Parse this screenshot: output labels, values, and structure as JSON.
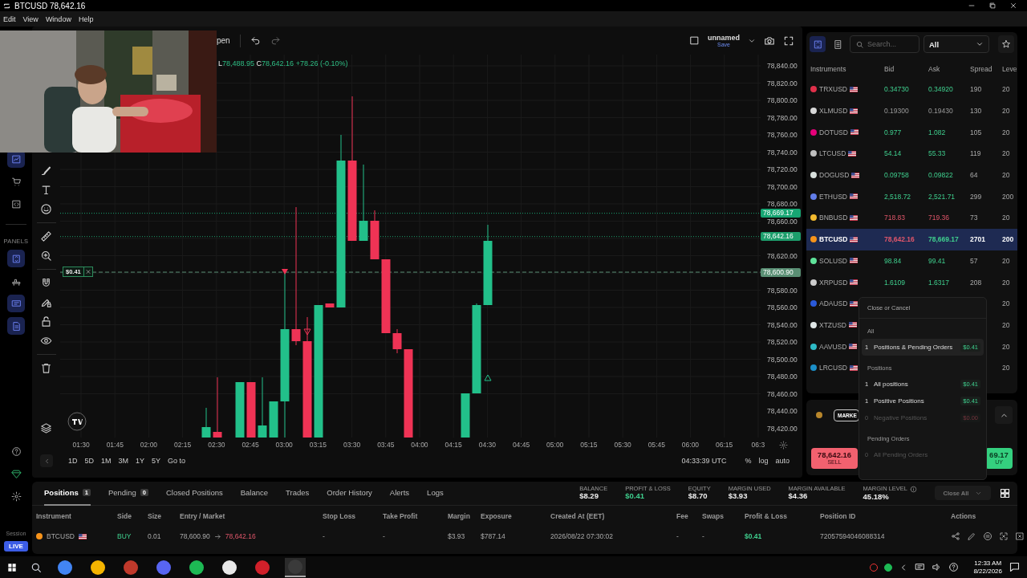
{
  "window": {
    "title": "BTCUSD 78,642.16"
  },
  "menu": [
    "Edit",
    "View",
    "Window",
    "Help"
  ],
  "sidebar": {
    "top_tools": [
      {
        "kind": "chart",
        "selected": true
      },
      {
        "kind": "cart",
        "selected": false
      },
      {
        "kind": "code",
        "selected": false
      }
    ],
    "section_label": "PANELS",
    "panels": [
      {
        "kind": "swap",
        "selected": true
      },
      {
        "kind": "desk",
        "selected": false
      },
      {
        "kind": "screen",
        "selected": true
      },
      {
        "kind": "docs",
        "selected": true
      }
    ],
    "bottom_tools": [
      {
        "kind": "help"
      },
      {
        "kind": "diamond"
      },
      {
        "kind": "gear"
      }
    ],
    "session_label": "Session",
    "mode_badge": "LIVE"
  },
  "chart": {
    "toolbar": {
      "open_label": "pen",
      "layout_name": "unnamed",
      "save_label": "Save"
    },
    "ohlc": {
      "low_label": "L",
      "low": "78,488.95",
      "close_label": "C",
      "close": "78,642.16",
      "change": "+78.26 (-0.10%)"
    },
    "price_ticks": [
      "78,840.00",
      "78,820.00",
      "78,800.00",
      "78,780.00",
      "78,760.00",
      "78,740.00",
      "78,720.00",
      "78,700.00",
      "78,680.00",
      "78,660.00",
      "78,620.00",
      "78,580.00",
      "78,560.00",
      "78,540.00",
      "78,520.00",
      "78,500.00",
      "78,480.00",
      "78,460.00",
      "78,440.00",
      "78,420.00"
    ],
    "price_tags": [
      {
        "value": "78,669.17",
        "kind": "ask"
      },
      {
        "value": "78,642.16",
        "kind": "bid"
      },
      {
        "value": "78,600.90",
        "kind": "entry"
      }
    ],
    "position_tag": "$0.41",
    "time_ticks": [
      "01:30",
      "01:45",
      "02:00",
      "02:15",
      "02:30",
      "02:45",
      "03:00",
      "03:15",
      "03:30",
      "03:45",
      "04:00",
      "04:15",
      "04:30",
      "04:45",
      "05:00",
      "05:15",
      "05:30",
      "05:45",
      "06:00",
      "06:15",
      "06:3"
    ],
    "ranges": [
      "1D",
      "5D",
      "1M",
      "3M",
      "1Y",
      "5Y"
    ],
    "goto": "Go to",
    "clock": "04:33:39 UTC",
    "scale_options": [
      "%",
      "log",
      "auto"
    ]
  },
  "instruments": {
    "search_placeholder": "Search...",
    "filter": "All",
    "columns": [
      "Instruments",
      "Bid",
      "Ask",
      "Spread",
      "Leve"
    ],
    "rows": [
      {
        "symbol": "TRXUSD",
        "color": "#e0304a",
        "bid": {
          "text": "0.34730",
          "kind": "up"
        },
        "ask": {
          "text": "0.34920",
          "kind": "up"
        },
        "spread": "190",
        "leverage": "20",
        "selected": false
      },
      {
        "symbol": "XLMUSD",
        "color": "#d8d8d8",
        "bid": {
          "text": "0.19300",
          "kind": "flat"
        },
        "ask": {
          "text": "0.19430",
          "kind": "flat"
        },
        "spread": "130",
        "leverage": "20",
        "selected": false
      },
      {
        "symbol": "DOTUSD",
        "color": "#e6007a",
        "bid": {
          "text": "0.977",
          "kind": "up"
        },
        "ask": {
          "text": "1.082",
          "kind": "up"
        },
        "spread": "105",
        "leverage": "20",
        "selected": false
      },
      {
        "symbol": "LTCUSD",
        "color": "#bfbfbf",
        "bid": {
          "text": "54.14",
          "kind": "up"
        },
        "ask": {
          "text": "55.33",
          "kind": "up"
        },
        "spread": "119",
        "leverage": "20",
        "selected": false
      },
      {
        "symbol": "DOGUSD",
        "color": "#d8e0dc",
        "bid": {
          "text": "0.09758",
          "kind": "up"
        },
        "ask": {
          "text": "0.09822",
          "kind": "up"
        },
        "spread": "64",
        "leverage": "20",
        "selected": false
      },
      {
        "symbol": "ETHUSD",
        "color": "#627eea",
        "bid": {
          "text": "2,518.72",
          "kind": "up"
        },
        "ask": {
          "text": "2,521.71",
          "kind": "up"
        },
        "spread": "299",
        "leverage": "200",
        "selected": false
      },
      {
        "symbol": "BNBUSD",
        "color": "#f3ba2f",
        "bid": {
          "text": "718.83",
          "kind": "down"
        },
        "ask": {
          "text": "719.36",
          "kind": "down"
        },
        "spread": "73",
        "leverage": "20",
        "selected": false
      },
      {
        "symbol": "BTCUSD",
        "color": "#f7931a",
        "bid": {
          "text": "78,642.16",
          "kind": "down"
        },
        "ask": {
          "text": "78,669.17",
          "kind": "up"
        },
        "spread": "2701",
        "leverage": "200",
        "selected": true
      },
      {
        "symbol": "SOLUSD",
        "color": "#5fe39a",
        "bid": {
          "text": "98.84",
          "kind": "up"
        },
        "ask": {
          "text": "99.41",
          "kind": "up"
        },
        "spread": "57",
        "leverage": "20",
        "selected": false
      },
      {
        "symbol": "XRPUSD",
        "color": "#cccccc",
        "bid": {
          "text": "1.6109",
          "kind": "up"
        },
        "ask": {
          "text": "1.6317",
          "kind": "up"
        },
        "spread": "208",
        "leverage": "20",
        "selected": false
      },
      {
        "symbol": "ADAUSD",
        "color": "#2a5ada",
        "leverage": "20",
        "selected": false
      },
      {
        "symbol": "XTZUSD",
        "color": "#e0e6e6",
        "leverage": "20",
        "selected": false
      },
      {
        "symbol": "AAVUSD",
        "color": "#2ebac6",
        "leverage": "20",
        "selected": false
      },
      {
        "symbol": "LRCUSD",
        "color": "#1c8fc8",
        "leverage": "20",
        "selected": false
      }
    ]
  },
  "order": {
    "color": "#b8862b",
    "type_button": "MARKE",
    "sell": {
      "price": "78,642.16",
      "label": "SELL"
    },
    "buy": {
      "price": "69.17",
      "label": "UY"
    }
  },
  "close_menu": {
    "title": "Close or Cancel",
    "sections": [
      {
        "heading": "All",
        "items": [
          {
            "count": "1",
            "label": "Positions & Pending Orders",
            "amount": {
              "text": "$0.41",
              "kind": "up"
            },
            "selected": true,
            "disabled": false
          }
        ]
      },
      {
        "heading": "Positions",
        "items": [
          {
            "count": "1",
            "label": "All positions",
            "amount": {
              "text": "$0.41",
              "kind": "up"
            },
            "selected": false,
            "disabled": false
          },
          {
            "count": "1",
            "label": "Positive Positions",
            "amount": {
              "text": "$0.41",
              "kind": "up"
            },
            "selected": false,
            "disabled": false
          },
          {
            "count": "0",
            "label": "Negative Positions",
            "amount": {
              "text": "$0.00",
              "kind": "down"
            },
            "selected": false,
            "disabled": true
          }
        ]
      },
      {
        "heading": "Pending Orders",
        "items": [
          {
            "count": "0",
            "label": "All Pending Orders",
            "selected": false,
            "disabled": true
          }
        ]
      }
    ]
  },
  "bottom": {
    "tabs": [
      {
        "label": "Positions",
        "count": "1",
        "selected": true
      },
      {
        "label": "Pending",
        "count": "0",
        "selected": false
      },
      {
        "label": "Closed Positions",
        "selected": false
      },
      {
        "label": "Balance",
        "selected": false
      },
      {
        "label": "Trades",
        "selected": false
      },
      {
        "label": "Order History",
        "selected": false
      },
      {
        "label": "Alerts",
        "selected": false
      },
      {
        "label": "Logs",
        "selected": false
      }
    ],
    "stats": [
      {
        "label": "BALANCE",
        "value": {
          "text": "$8.29",
          "kind": "plain"
        },
        "info": false
      },
      {
        "label": "PROFIT & LOSS",
        "value": {
          "text": "$0.41",
          "kind": "up"
        },
        "info": false
      },
      {
        "label": "EQUITY",
        "value": {
          "text": "$8.70",
          "kind": "plain"
        },
        "info": false
      },
      {
        "label": "MARGIN USED",
        "value": {
          "text": "$3.93",
          "kind": "plain"
        },
        "info": false
      },
      {
        "label": "MARGIN AVAILABLE",
        "value": {
          "text": "$4.36",
          "kind": "plain"
        },
        "info": false
      },
      {
        "label": "MARGIN LEVEL",
        "value": {
          "text": "45.18%",
          "kind": "plain"
        },
        "info": true
      }
    ],
    "close_all": "Close All",
    "columns": [
      "Instrument",
      "Side",
      "Size",
      "Entry / Market",
      "Stop Loss",
      "Take Profit",
      "Margin",
      "Exposure",
      "Created At (EET)",
      "Fee",
      "Swaps",
      "Profit & Loss",
      "Position ID",
      "Actions"
    ],
    "rows": [
      {
        "instrument": "BTCUSD",
        "color": "#f7931a",
        "side": "BUY",
        "size": "0.01",
        "entry": "78,600.90",
        "market": {
          "text": "78,642.16",
          "kind": "down"
        },
        "stop_loss": "-",
        "take_profit": "-",
        "margin": "$3.93",
        "exposure": "$787.14",
        "created_at": "2026/08/22 07:30:02",
        "fee": "-",
        "swaps": "-",
        "pnl": {
          "text": "$0.41",
          "kind": "up"
        },
        "position_id": "72057594046088314"
      }
    ]
  },
  "taskbar": {
    "apps": [
      {
        "color": "#4285f4",
        "selected": false
      },
      {
        "color": "#f4b400",
        "selected": false
      },
      {
        "color": "#c0392b",
        "selected": false
      },
      {
        "color": "#5865f2",
        "selected": false
      },
      {
        "color": "#1db954",
        "selected": false
      },
      {
        "color": "#e8e8e8",
        "selected": false
      },
      {
        "color": "#d0202a",
        "selected": false
      },
      {
        "color": "#3a3a3a",
        "selected": true
      }
    ],
    "time": "12:33 AM",
    "date": "8/22/2026"
  }
}
